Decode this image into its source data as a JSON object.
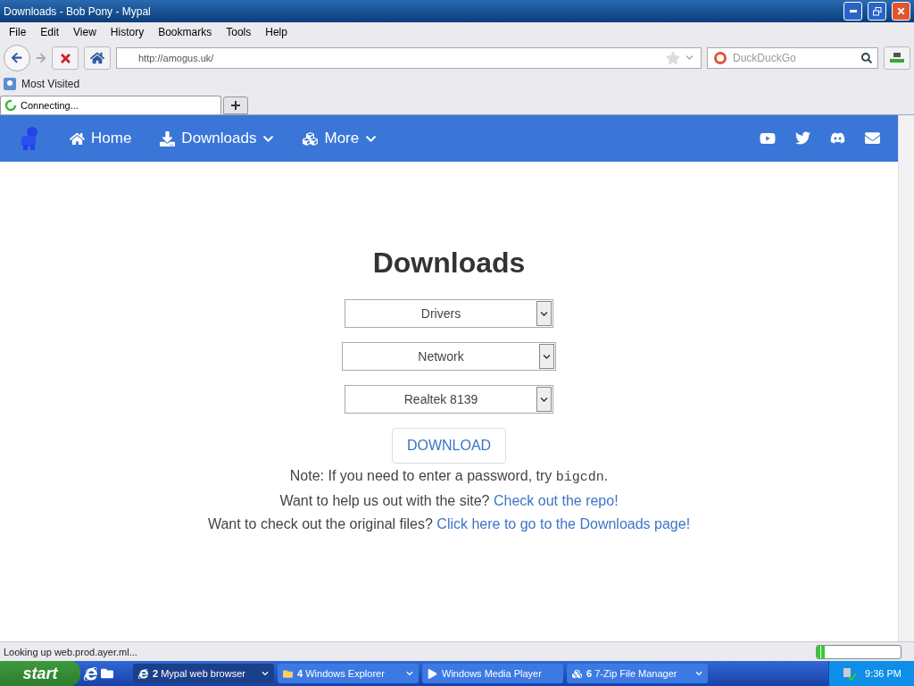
{
  "window": {
    "title": "Downloads - Bob Pony - Mypal"
  },
  "menu": [
    "File",
    "Edit",
    "View",
    "History",
    "Bookmarks",
    "Tools",
    "Help"
  ],
  "address": {
    "value": "http://amogus.uk/"
  },
  "search": {
    "placeholder": "DuckDuckGo"
  },
  "bookmarks": [
    {
      "label": "Most Visited"
    }
  ],
  "tabs": [
    {
      "label": "Connecting...",
      "selected": true,
      "loading": true
    }
  ],
  "site_nav": {
    "items": [
      {
        "label": "Home",
        "dropdown": false
      },
      {
        "label": "Downloads",
        "dropdown": true
      },
      {
        "label": "More",
        "dropdown": true
      }
    ]
  },
  "content": {
    "heading": "Downloads",
    "selects": [
      {
        "value": "Drivers"
      },
      {
        "value": "Network"
      },
      {
        "value": "Realtek 8139"
      }
    ],
    "button": "DOWNLOAD",
    "note": {
      "text": "Note: If you need to enter a password, try ",
      "code": "bigcdn",
      "end": "."
    },
    "lines": [
      {
        "text": "Want to help us out with the site? ",
        "link": "Check out the repo!"
      },
      {
        "text": "Want to check out the original files? ",
        "link": "Click here to go to the Downloads page!"
      }
    ]
  },
  "status_bar": {
    "text": "Looking up web.prod.ayer.ml...",
    "level": 0.1
  },
  "taskbar": {
    "start": "start",
    "items": [
      {
        "count": "2",
        "label": "Mypal web browser",
        "selected": true,
        "grouped": true
      },
      {
        "count": "4",
        "label": "Windows Explorer",
        "selected": false,
        "grouped": true
      },
      {
        "label": "Windows Media Player",
        "selected": false,
        "grouped": false
      },
      {
        "count": "6",
        "label": "7-Zip File Manager",
        "selected": false,
        "grouped": true
      }
    ],
    "clock": "9:36 PM"
  }
}
